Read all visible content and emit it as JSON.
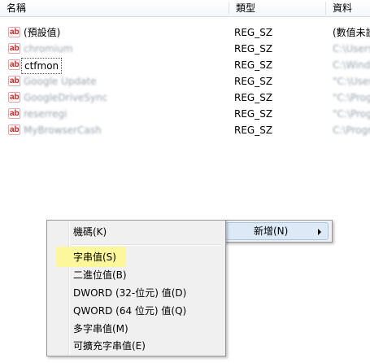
{
  "columns": {
    "name": "名稱",
    "type": "類型",
    "data": "資料"
  },
  "rows": [
    {
      "name": "(預設值)",
      "type": "REG_SZ",
      "data": "(數值未設"
    },
    {
      "name": "chromium",
      "type": "REG_SZ",
      "data": "C:\\Users\\"
    },
    {
      "name": "ctfmon",
      "type": "REG_SZ",
      "data": "C:\\Wind"
    },
    {
      "name": "Google Update",
      "type": "REG_SZ",
      "data": "\"C:\\User"
    },
    {
      "name": "GoogleDriveSync",
      "type": "REG_SZ",
      "data": "\"C:\\Prog"
    },
    {
      "name": "reserregi",
      "type": "REG_SZ",
      "data": "\"C:\\Prog"
    },
    {
      "name": "MyBrowserCash",
      "type": "REG_SZ",
      "data": "C:\\Progr"
    }
  ],
  "context_menu": {
    "key_label": "機碼(K)",
    "new_label": "新增(N)"
  },
  "submenu": {
    "items": [
      "字串值(S)",
      "二進位值(B)",
      "DWORD (32-位元) 值(D)",
      "QWORD (64 位元) 值(Q)",
      "多字串值(M)",
      "可擴充字串值(E)"
    ]
  },
  "icon_text": "ab",
  "colors": {
    "highlight": "#fbf79a",
    "icon": "#cc1f1f"
  }
}
